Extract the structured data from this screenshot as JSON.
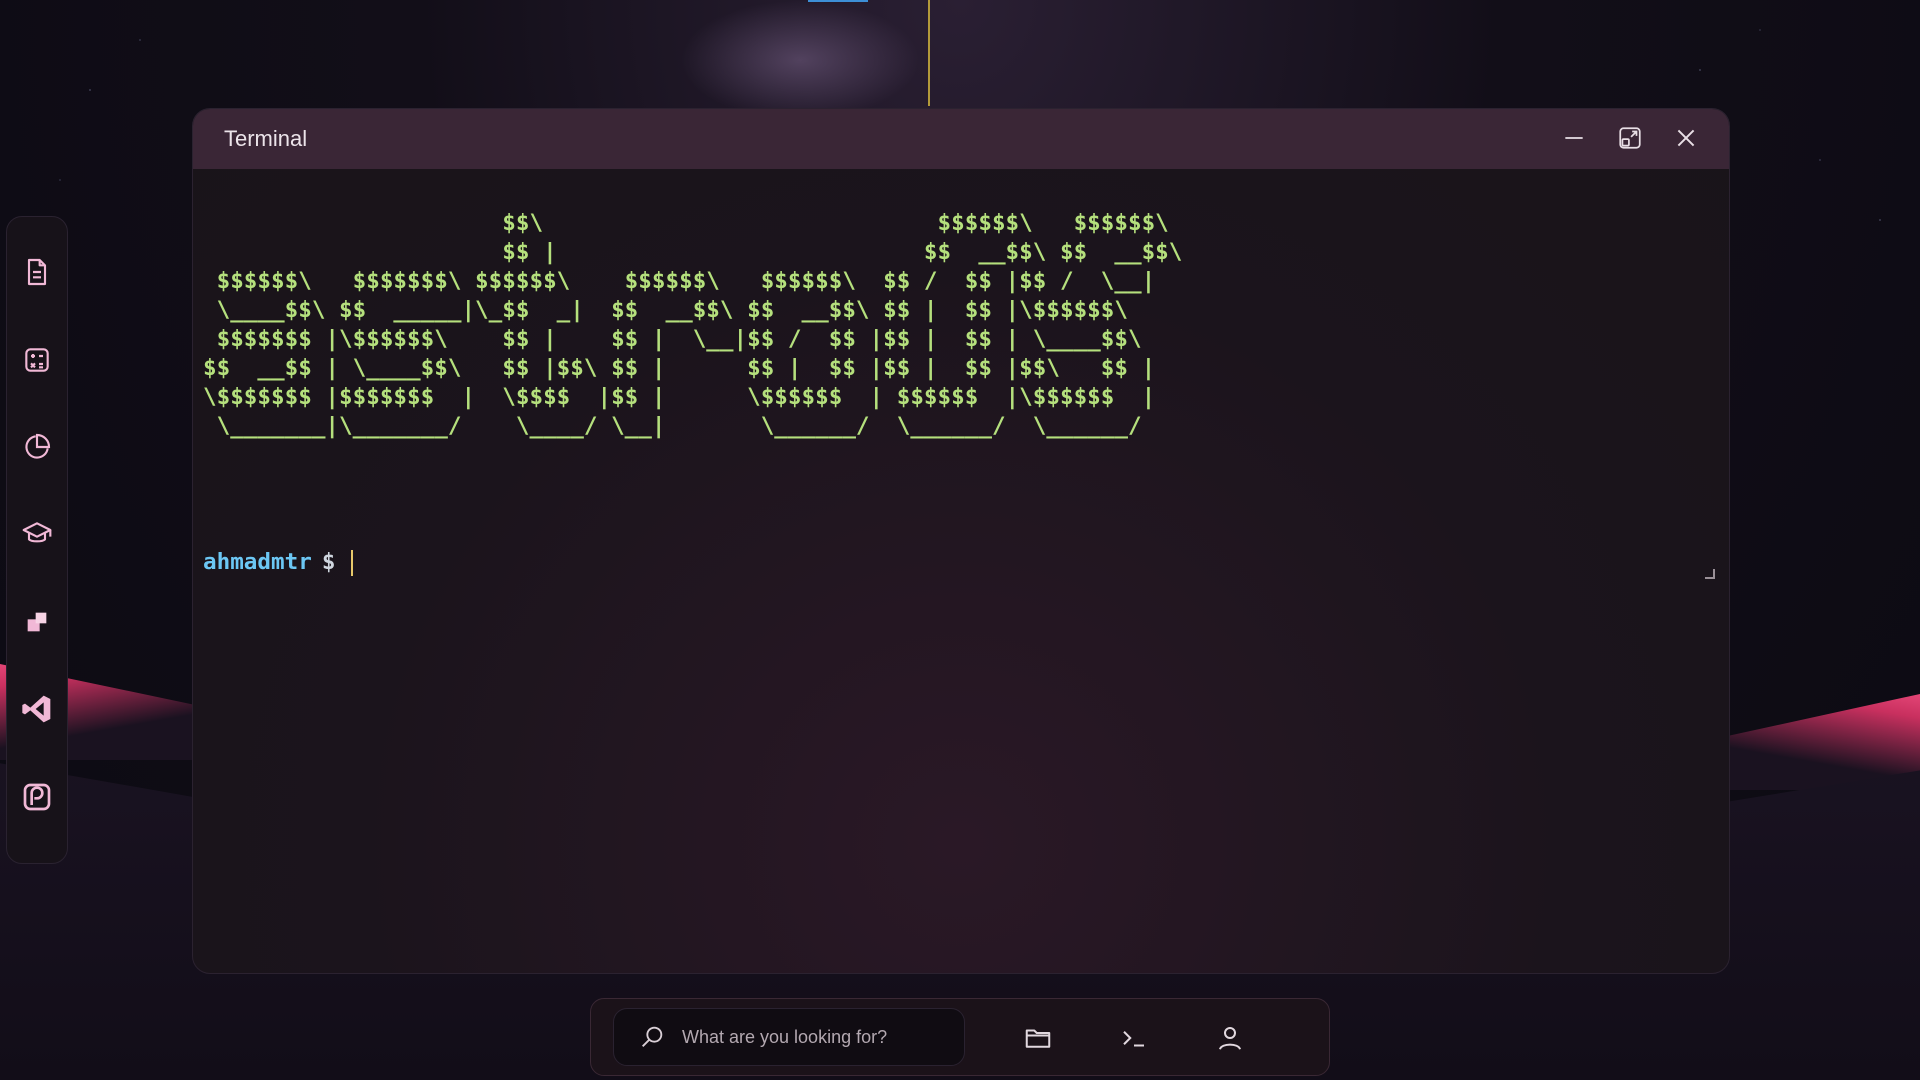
{
  "window": {
    "title": "Terminal",
    "controls": [
      {
        "name": "minimize-icon"
      },
      {
        "name": "maximize-icon"
      },
      {
        "name": "close-icon"
      }
    ]
  },
  "terminal": {
    "ascii_art": "                      $$\\                             $$$$$$\\   $$$$$$\\\n                      $$ |                           $$  __$$\\ $$  __$$\\\n $$$$$$\\   $$$$$$$\\ $$$$$$\\    $$$$$$\\   $$$$$$\\  $$ /  $$ |$$ /  \\__|\n \\____$$\\ $$  _____|\\_$$  _|  $$  __$$\\ $$  __$$\\ $$ |  $$ |\\$$$$$$\\\n $$$$$$$ |\\$$$$$$\\    $$ |    $$ |  \\__|$$ /  $$ |$$ |  $$ | \\____$$\\\n$$  __$$ | \\____$$\\   $$ |$$\\ $$ |      $$ |  $$ |$$ |  $$ |$$\\   $$ |\n\\$$$$$$$ |$$$$$$$  |  \\$$$$  |$$ |      \\$$$$$$  | $$$$$$  |\\$$$$$$  |\n \\_______|\\_______/    \\____/ \\__|       \\______/  \\______/  \\______/",
    "prompt_user": "ahmadmtr",
    "prompt_symbol": "$"
  },
  "dock": {
    "items": [
      {
        "name": "document-icon"
      },
      {
        "name": "calculator-icon"
      },
      {
        "name": "chart-icon"
      },
      {
        "name": "graduation-cap-icon"
      },
      {
        "name": "squares-icon"
      },
      {
        "name": "vscode-icon"
      },
      {
        "name": "p-logo-icon"
      }
    ]
  },
  "taskbar": {
    "search_placeholder": "What are you looking for?",
    "icons": [
      "folder-icon",
      "terminal-icon",
      "user-icon"
    ]
  },
  "colors": {
    "accent_green": "#b5e07d",
    "prompt_blue": "#6cc7f4",
    "titlebar": "#3a2636",
    "dock_icon": "#f1b8d6"
  }
}
